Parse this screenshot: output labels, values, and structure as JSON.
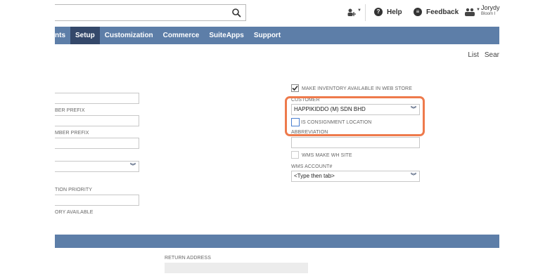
{
  "header": {
    "help_label": "Help",
    "feedback_label": "Feedback",
    "user_name": "Jorydy",
    "user_sub": "Bloom I"
  },
  "nav": {
    "items": [
      {
        "label": "nts"
      },
      {
        "label": "Setup"
      },
      {
        "label": "Customization"
      },
      {
        "label": "Commerce"
      },
      {
        "label": "SuiteApps"
      },
      {
        "label": "Support"
      }
    ]
  },
  "page_links": {
    "list": "List",
    "search": "Sear"
  },
  "left_fields": {
    "label_1": "BER PREFIX",
    "label_2": "MBER PREFIX",
    "label_3": "TION PRIORITY",
    "label_4": "ORY AVAILABLE"
  },
  "right_fields": {
    "make_inventory_label": "MAKE INVENTORY AVAILABLE IN WEB STORE",
    "make_inventory_checked": true,
    "customer_label": "CUSTOMER",
    "customer_value": "HAPPIKIDDO (M) SDN BHD",
    "consignment_label": "IS CONSIGNMENT LOCATION",
    "consignment_checked": false,
    "abbreviation_label": "ABBREVIATION",
    "abbreviation_value": "",
    "wms_make_wh_label": "WMS MAKE WH SITE",
    "wms_make_wh_checked": false,
    "wms_account_label": "WMS ACCOUNT#",
    "wms_account_value": "<Type then tab>"
  },
  "return_address": {
    "label": "RETURN ADDRESS"
  },
  "colors": {
    "nav_bg": "#5d7ea8",
    "nav_active": "#34486a",
    "highlight": "#ee7a4c"
  }
}
